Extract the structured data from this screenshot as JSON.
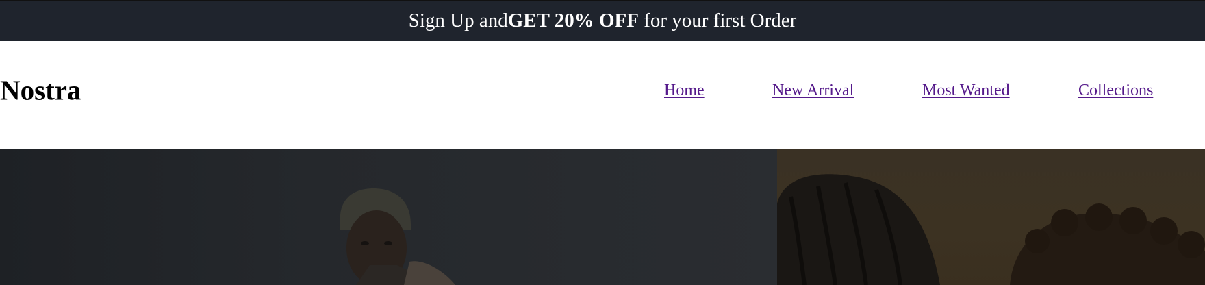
{
  "promo": {
    "prefix": "Sign Up and",
    "highlight": "GET 20% OFF",
    "suffix": " for your first Order"
  },
  "header": {
    "logo": "Nostra",
    "nav": [
      {
        "label": "Home"
      },
      {
        "label": "New Arrival"
      },
      {
        "label": "Most Wanted"
      },
      {
        "label": "Collections"
      }
    ]
  },
  "hero": {
    "left_image": "man-in-beanie-photo",
    "right_image": "women-hair-photo"
  }
}
